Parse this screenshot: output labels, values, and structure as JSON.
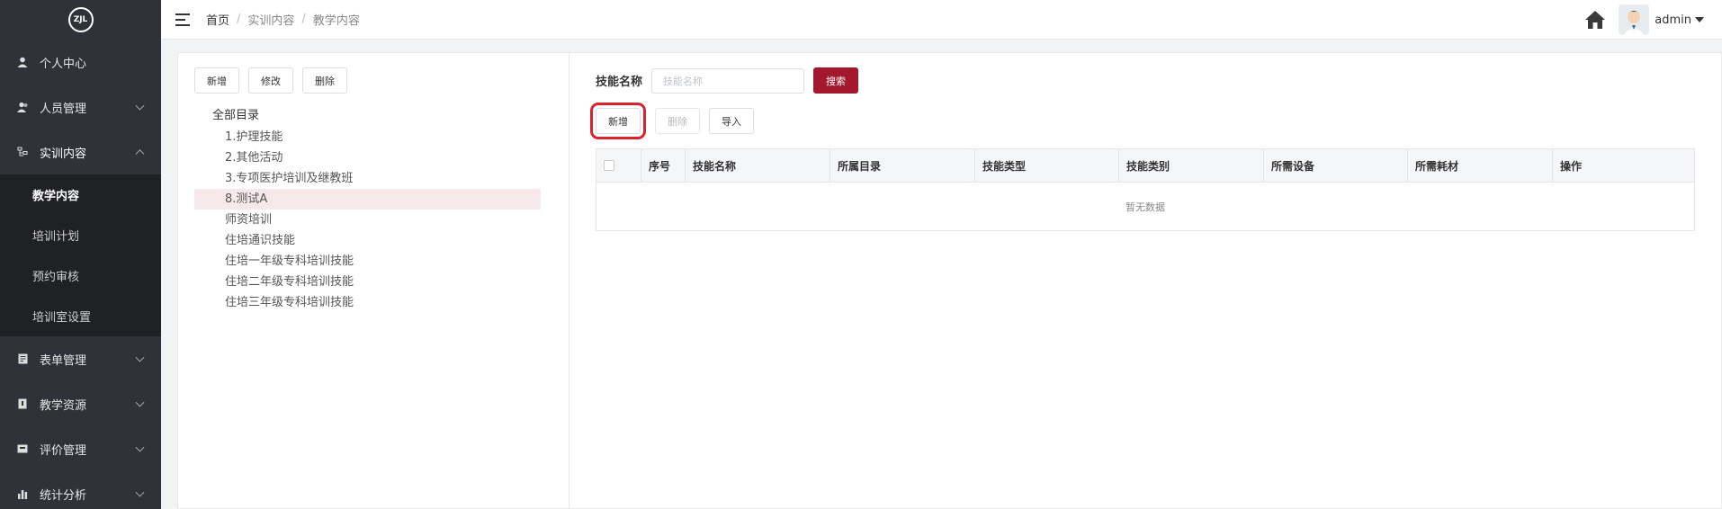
{
  "app": {
    "logo_text": "ZJL"
  },
  "sidebar": {
    "items": [
      {
        "label": "个人中心",
        "icon": "user-icon",
        "has_children": false
      },
      {
        "label": "人员管理",
        "icon": "users-icon",
        "has_children": true
      },
      {
        "label": "实训内容",
        "icon": "tree-icon",
        "has_children": true,
        "open": true,
        "children": [
          "教学内容",
          "培训计划",
          "预约审核",
          "培训室设置"
        ],
        "active_child": 0
      },
      {
        "label": "表单管理",
        "icon": "form-icon",
        "has_children": true
      },
      {
        "label": "教学资源",
        "icon": "book-icon",
        "has_children": true
      },
      {
        "label": "评价管理",
        "icon": "rating-icon",
        "has_children": true
      },
      {
        "label": "统计分析",
        "icon": "bar-chart-icon",
        "has_children": true
      }
    ]
  },
  "header": {
    "breadcrumb": [
      "首页",
      "实训内容",
      "教学内容"
    ],
    "username": "admin"
  },
  "left": {
    "buttons": {
      "add": "新增",
      "edit": "修改",
      "delete": "删除"
    },
    "tree": {
      "root": "全部目录",
      "nodes": [
        "1.护理技能",
        "2.其他活动",
        "3.专项医护培训及继教班",
        "8.测试A",
        "师资培训",
        "住培通识技能",
        "住培一年级专科培训技能",
        "住培二年级专科培训技能",
        "住培三年级专科培训技能"
      ],
      "active_index": 3
    }
  },
  "right": {
    "search": {
      "label": "技能名称",
      "placeholder": "技能名称",
      "button": "搜索"
    },
    "actions": {
      "add": "新增",
      "delete": "删除",
      "import": "导入"
    },
    "table": {
      "columns": [
        "序号",
        "技能名称",
        "所属目录",
        "技能类型",
        "技能类别",
        "所需设备",
        "所需耗材",
        "操作"
      ],
      "empty_text": "暂无数据"
    }
  },
  "colors": {
    "sidebar_bg": "#2f3238",
    "submenu_bg": "#1f2125",
    "primary": "#a3182d",
    "highlight": "#d9232e",
    "active_row": "#f7e8eb"
  }
}
